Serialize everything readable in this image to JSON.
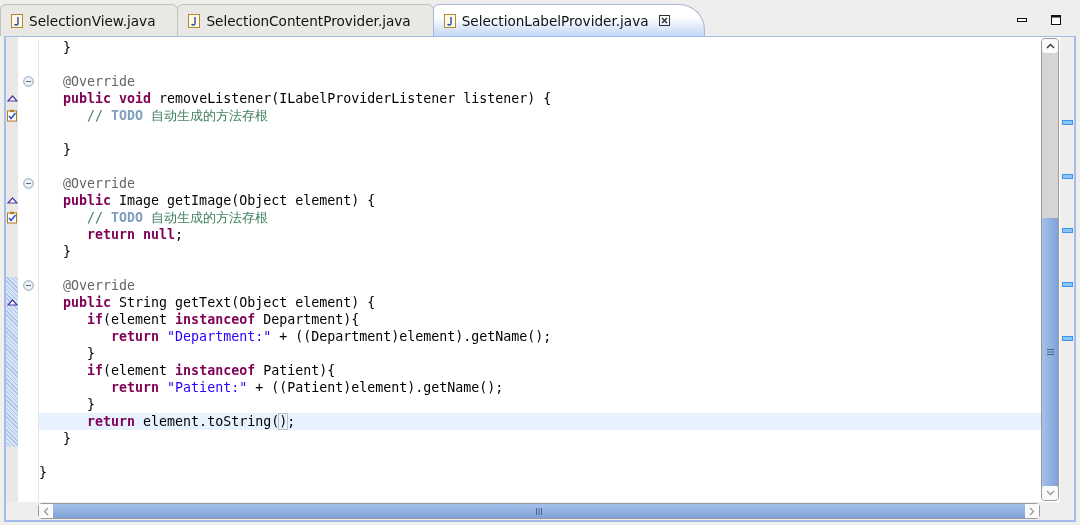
{
  "tabs": [
    {
      "label": "SelectionView.java",
      "selected": false
    },
    {
      "label": "SelectionContentProvider.java",
      "selected": false
    },
    {
      "label": "SelectionLabelProvider.java",
      "selected": true
    }
  ],
  "editor": {
    "lines": [
      {
        "tokens": [
          {
            "kind": "plain",
            "text": "   }"
          }
        ],
        "in_range": false,
        "current": false
      },
      {
        "in_range": false,
        "current": false
      },
      {
        "tokens": [
          {
            "kind": "annotation",
            "text": "   @Override"
          }
        ],
        "fold": {
          "expanded": true
        },
        "in_range": false,
        "current": false
      },
      {
        "tokens": [
          {
            "kind": "keyword",
            "text": "   public"
          },
          {
            "kind": "keyword",
            "text": " void"
          },
          {
            "kind": "plain",
            "text": " removeListener(ILabelProviderListener listener) {"
          }
        ],
        "marker": {
          "kind": "override"
        },
        "in_range": false,
        "current": false
      },
      {
        "tokens": [
          {
            "kind": "comment",
            "text": "      // "
          },
          {
            "kind": "task",
            "text": "TODO"
          },
          {
            "kind": "comment",
            "text": " 自动生成的方法存根"
          }
        ],
        "marker": {
          "kind": "task"
        },
        "in_range": false,
        "current": false
      },
      {
        "in_range": false,
        "current": false
      },
      {
        "tokens": [
          {
            "kind": "plain",
            "text": "   }"
          }
        ],
        "in_range": false,
        "current": false
      },
      {
        "in_range": false,
        "current": false
      },
      {
        "tokens": [
          {
            "kind": "annotation",
            "text": "   @Override"
          }
        ],
        "fold": {
          "expanded": true
        },
        "in_range": false,
        "current": false
      },
      {
        "tokens": [
          {
            "kind": "keyword",
            "text": "   public"
          },
          {
            "kind": "plain",
            "text": " Image getImage(Object element) {"
          }
        ],
        "marker": {
          "kind": "override"
        },
        "in_range": false,
        "current": false
      },
      {
        "tokens": [
          {
            "kind": "comment",
            "text": "      // "
          },
          {
            "kind": "task",
            "text": "TODO"
          },
          {
            "kind": "comment",
            "text": " 自动生成的方法存根"
          }
        ],
        "marker": {
          "kind": "task"
        },
        "in_range": false,
        "current": false
      },
      {
        "tokens": [
          {
            "kind": "keyword",
            "text": "      return"
          },
          {
            "kind": "keyword",
            "text": " null"
          },
          {
            "kind": "plain",
            "text": ";"
          }
        ],
        "in_range": false,
        "current": false
      },
      {
        "tokens": [
          {
            "kind": "plain",
            "text": "   }"
          }
        ],
        "in_range": false,
        "current": false
      },
      {
        "in_range": false,
        "current": false
      },
      {
        "tokens": [
          {
            "kind": "annotation",
            "text": "   @Override"
          }
        ],
        "fold": {
          "expanded": true
        },
        "in_range": true,
        "current": false
      },
      {
        "tokens": [
          {
            "kind": "keyword",
            "text": "   public"
          },
          {
            "kind": "plain",
            "text": " String getText(Object element) {"
          }
        ],
        "marker": {
          "kind": "override"
        },
        "in_range": true,
        "current": false
      },
      {
        "tokens": [
          {
            "kind": "keyword",
            "text": "      if"
          },
          {
            "kind": "plain",
            "text": "(element "
          },
          {
            "kind": "keyword",
            "text": "instanceof"
          },
          {
            "kind": "plain",
            "text": " Department){"
          }
        ],
        "in_range": true,
        "current": false
      },
      {
        "tokens": [
          {
            "kind": "keyword",
            "text": "         return"
          },
          {
            "kind": "string",
            "text": " \"Department:\""
          },
          {
            "kind": "plain",
            "text": " + ((Department)element).getName();"
          }
        ],
        "in_range": true,
        "current": false
      },
      {
        "tokens": [
          {
            "kind": "plain",
            "text": "      }"
          }
        ],
        "in_range": true,
        "current": false
      },
      {
        "tokens": [
          {
            "kind": "keyword",
            "text": "      if"
          },
          {
            "kind": "plain",
            "text": "(element "
          },
          {
            "kind": "keyword",
            "text": "instanceof"
          },
          {
            "kind": "plain",
            "text": " Patient){"
          }
        ],
        "in_range": true,
        "current": false
      },
      {
        "tokens": [
          {
            "kind": "keyword",
            "text": "         return"
          },
          {
            "kind": "string",
            "text": " \"Patient:\""
          },
          {
            "kind": "plain",
            "text": " + ((Patient)element).getName();"
          }
        ],
        "in_range": true,
        "current": false
      },
      {
        "tokens": [
          {
            "kind": "plain",
            "text": "      }"
          }
        ],
        "in_range": true,
        "current": false
      },
      {
        "tokens": [
          {
            "kind": "keyword",
            "text": "      return"
          },
          {
            "kind": "plain",
            "text": " element.toString("
          },
          {
            "kind": "matched_bracket",
            "text": ")"
          },
          {
            "kind": "plain",
            "text": ";"
          }
        ],
        "in_range": true,
        "current": true
      },
      {
        "tokens": [
          {
            "kind": "plain",
            "text": "   }"
          }
        ],
        "in_range": true,
        "current": false
      },
      {
        "in_range": false,
        "current": false
      },
      {
        "tokens": [
          {
            "kind": "plain",
            "text": "}"
          }
        ],
        "in_range": false,
        "current": false
      }
    ]
  }
}
